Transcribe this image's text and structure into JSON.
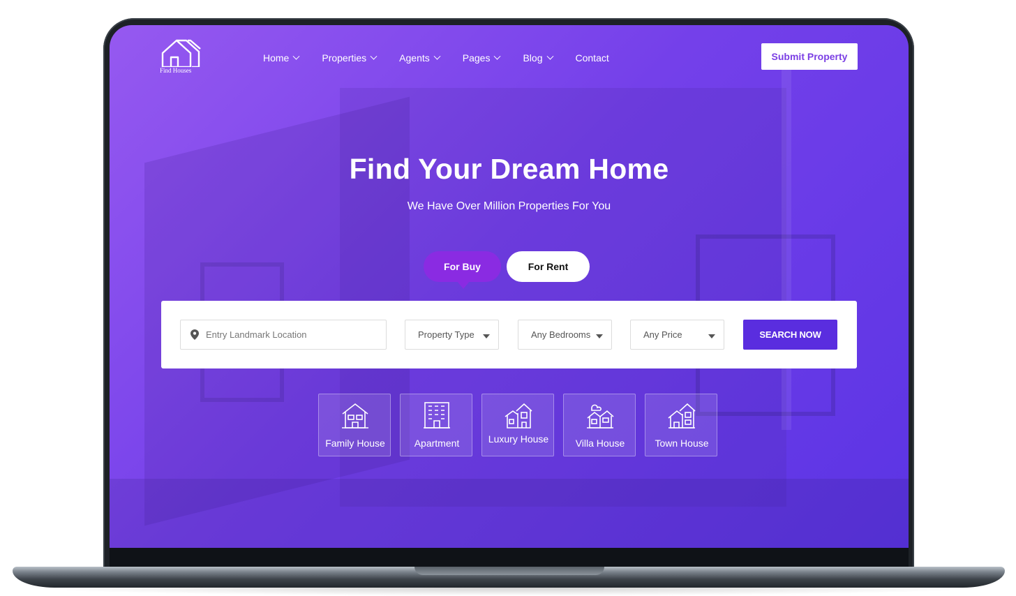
{
  "logo": {
    "text": "Find Houses",
    "icon": "house-logo-icon"
  },
  "nav": {
    "items": [
      {
        "label": "Home",
        "has_dropdown": true
      },
      {
        "label": "Properties",
        "has_dropdown": true
      },
      {
        "label": "Agents",
        "has_dropdown": true
      },
      {
        "label": "Pages",
        "has_dropdown": true
      },
      {
        "label": "Blog",
        "has_dropdown": true
      },
      {
        "label": "Contact",
        "has_dropdown": false
      }
    ],
    "submit_label": "Submit Property"
  },
  "hero": {
    "title": "Find Your Dream Home",
    "subtitle": "We Have Over Million Properties For You"
  },
  "tabs": {
    "buy_label": "For Buy",
    "rent_label": "For Rent",
    "active": "For Buy"
  },
  "search": {
    "location_placeholder": "Entry Landmark Location",
    "property_type": "Property Type",
    "bedrooms": "Any Bedrooms",
    "price": "Any Price",
    "button_label": "SEARCH NOW"
  },
  "categories": [
    {
      "label": "Family House",
      "icon": "family-house-icon"
    },
    {
      "label": "Apartment",
      "icon": "apartment-icon"
    },
    {
      "label": "Luxury House",
      "icon": "luxury-house-icon"
    },
    {
      "label": "Villa House",
      "icon": "villa-house-icon"
    },
    {
      "label": "Town House",
      "icon": "town-house-icon"
    }
  ],
  "colors": {
    "accent": "#8a2be2",
    "button": "#5a2ddf",
    "brand_text": "#7b3fe4",
    "hero_gradient_start": "#9659f0",
    "hero_gradient_end": "#5b34e4"
  }
}
